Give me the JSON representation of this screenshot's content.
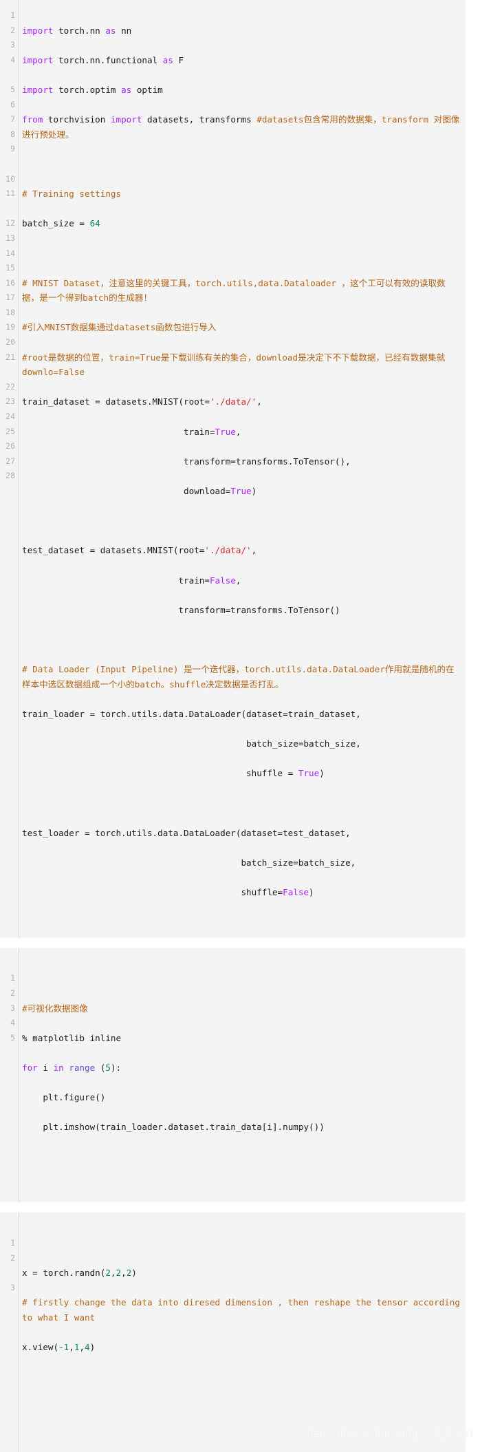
{
  "watermark": "https://blog.csdn.net/qq_35547281",
  "cells": [
    {
      "id": "cell-1",
      "line_numbers": [
        "1",
        "2",
        "3",
        "4",
        "",
        "5",
        "6",
        "7",
        "8",
        "9",
        "",
        "10",
        "11",
        "",
        "12",
        "13",
        "14",
        "15",
        "16",
        "17",
        "18",
        "19",
        "20",
        "21",
        "",
        "22",
        "23",
        "24",
        "25",
        "26",
        "27",
        "28"
      ],
      "lines": [
        "import torch.nn as nn",
        "import torch.nn.functional as F",
        "import torch.optim as optim",
        "from torchvision import datasets, transforms #datasets包含常用的数据集，transform 对图像进行预处理。",
        "",
        "# Training settings",
        "batch_size = 64",
        "",
        "# MNIST Dataset，注意这里的关键工具，torch.utils,data.Dataloader ，这个工可以有效的读取数据，是一个得到batch的生成器！",
        "#引入MNIST数据集通过datasets函数包进行导入",
        "#root是数据的位置，train=True是下载训练有关的集合，download是决定下不下载数据，已经有数据集就downlo=False",
        "train_dataset = datasets.MNIST(root='./data/',",
        "                               train=True,",
        "                               transform=transforms.ToTensor(),",
        "                               download=True)",
        "",
        "test_dataset = datasets.MNIST(root='./data/',",
        "                              train=False,",
        "                              transform=transforms.ToTensor()",
        "",
        "# Data Loader (Input Pipeline) 是一个迭代器，torch.utils.data.DataLoader作用就是随机的在样本中选区数据组成一个小的batch。shuffle决定数据是否打乱。",
        "train_loader = torch.utils.data.DataLoader(dataset=train_dataset,",
        "                                           batch_size=batch_size,",
        "                                           shuffle = True)",
        "",
        "test_loader = torch.utils.data.DataLoader(dataset=test_dataset,",
        "                                          batch_size=batch_size,",
        "                                          shuffle=False)"
      ]
    },
    {
      "id": "cell-2",
      "line_numbers": [
        "",
        "1",
        "2",
        "3",
        "4",
        "5",
        ""
      ],
      "lines": [
        "#可视化数据图像",
        "% matplotlib inline",
        "for i in range (5):",
        "    plt.figure()",
        "    plt.imshow(train_loader.dataset.train_data[i].numpy())"
      ]
    },
    {
      "id": "cell-3",
      "line_numbers": [
        "",
        "1",
        "2",
        "",
        "3",
        ""
      ],
      "lines": [
        "x = torch.randn(2,2,2)",
        "# firstly change the data into diresed dimension , then reshape the tensor according to what I want",
        "x.view(-1,1,4)"
      ]
    }
  ]
}
